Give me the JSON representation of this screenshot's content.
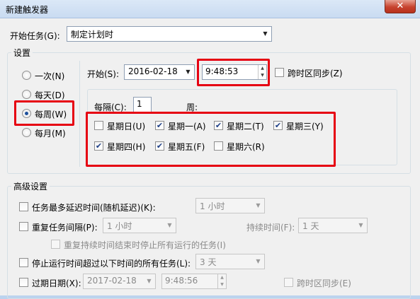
{
  "window": {
    "title": "新建触发器",
    "close_glyph": "✕"
  },
  "start_task": {
    "label": "开始任务(G):",
    "value": "制定计划时"
  },
  "settings": {
    "group_label": "设置",
    "radios": [
      {
        "label": "一次(N)",
        "checked": false
      },
      {
        "label": "每天(D)",
        "checked": false
      },
      {
        "label": "每周(W)",
        "checked": true
      },
      {
        "label": "每月(M)",
        "checked": false
      }
    ],
    "start_label": "开始(S):",
    "start_date": "2016-02-18",
    "start_time": "9:48:53",
    "sync_tz_label": "跨时区同步(Z)",
    "every_label": "每隔(C):",
    "every_value": "1",
    "weeks_label": "周:",
    "days": [
      {
        "label": "星期日(U)",
        "checked": false
      },
      {
        "label": "星期一(A)",
        "checked": true
      },
      {
        "label": "星期二(T)",
        "checked": true
      },
      {
        "label": "星期三(Y)",
        "checked": true
      },
      {
        "label": "星期四(H)",
        "checked": true
      },
      {
        "label": "星期五(F)",
        "checked": true
      },
      {
        "label": "星期六(R)",
        "checked": false
      }
    ]
  },
  "advanced": {
    "group_label": "高级设置",
    "delay_label": "任务最多延迟时间(随机延迟)(K):",
    "delay_value": "1 小时",
    "repeat_label": "重复任务间隔(P):",
    "repeat_value": "1 小时",
    "duration_label": "持续时间(F):",
    "duration_value": "1 天",
    "stop_all_label": "重复持续时间结束时停止所有运行的任务(I)",
    "stop_long_label": "停止运行时间超过以下时间的所有任务(L):",
    "stop_long_value": "3 天",
    "expire_label": "过期日期(X):",
    "expire_date": "2017-02-18",
    "expire_time": "9:48:56",
    "expire_sync_label": "跨时区同步(E)"
  },
  "accent_color": "#e60012",
  "check_glyph": "✔"
}
